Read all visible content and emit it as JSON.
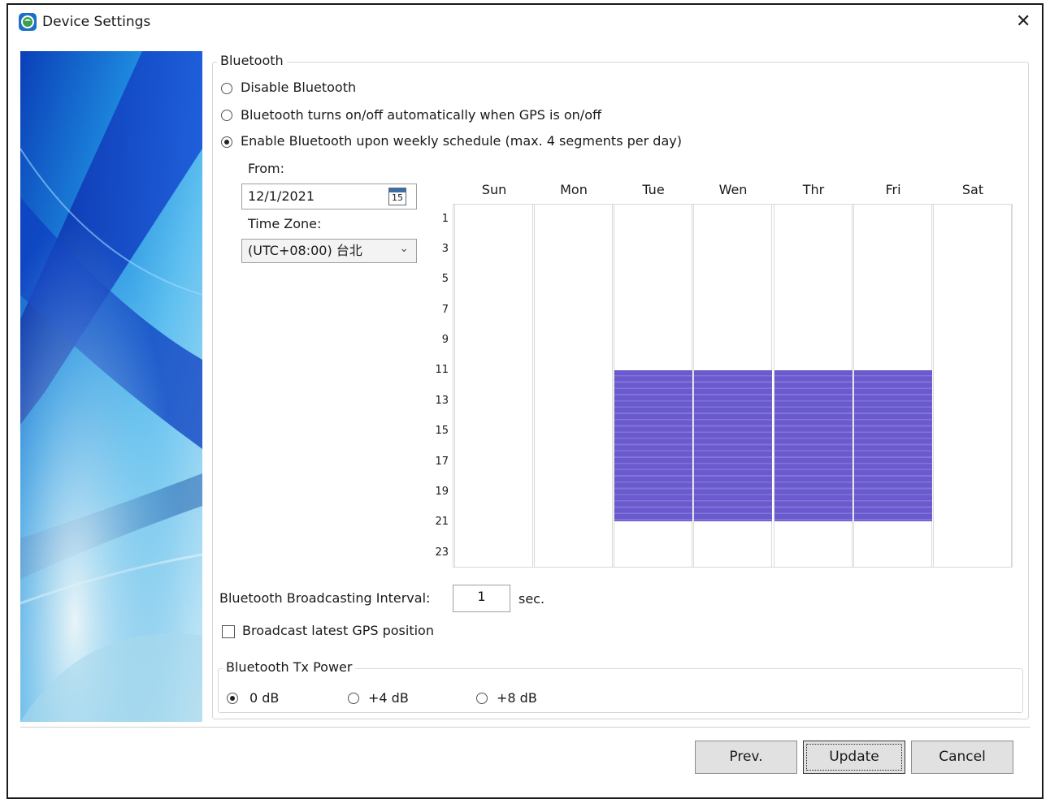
{
  "window": {
    "title": "Device Settings",
    "close_label": "✕"
  },
  "bluetooth": {
    "group_title": "Bluetooth",
    "options": [
      {
        "label": "Disable Bluetooth",
        "checked": false
      },
      {
        "label": "Bluetooth turns on/off automatically when GPS is on/off",
        "checked": false
      },
      {
        "label": "Enable Bluetooth upon weekly schedule (max. 4 segments per day)",
        "checked": true
      }
    ],
    "from_label": "From:",
    "from_value": "12/1/2021",
    "calendar_day": "15",
    "timezone_label": "Time Zone:",
    "timezone_value": "(UTC+08:00) 台北",
    "dropdown_arrow": "⌄"
  },
  "schedule": {
    "days": [
      "Sun",
      "Mon",
      "Tue",
      "Wen",
      "Thr",
      "Fri",
      "Sat"
    ],
    "hour_labels": [
      "1",
      "3",
      "5",
      "7",
      "9",
      "11",
      "13",
      "15",
      "17",
      "19",
      "21",
      "23"
    ],
    "active_days": [
      "Tue",
      "Wen",
      "Thr",
      "Fri"
    ],
    "active_start_hour": 11,
    "active_end_hour": 21,
    "block_color": "#6a5acd"
  },
  "broadcast": {
    "interval_label": "Bluetooth Broadcasting Interval:",
    "interval_value": "1",
    "interval_unit": "sec.",
    "gps_checkbox_label": "Broadcast latest GPS position",
    "gps_checked": false
  },
  "tx_power": {
    "group_title": "Bluetooth Tx Power",
    "options": [
      {
        "label": "0 dB",
        "checked": true
      },
      {
        "label": "+4 dB",
        "checked": false
      },
      {
        "label": "+8 dB",
        "checked": false
      }
    ]
  },
  "buttons": {
    "prev": "Prev.",
    "update": "Update",
    "cancel": "Cancel"
  }
}
